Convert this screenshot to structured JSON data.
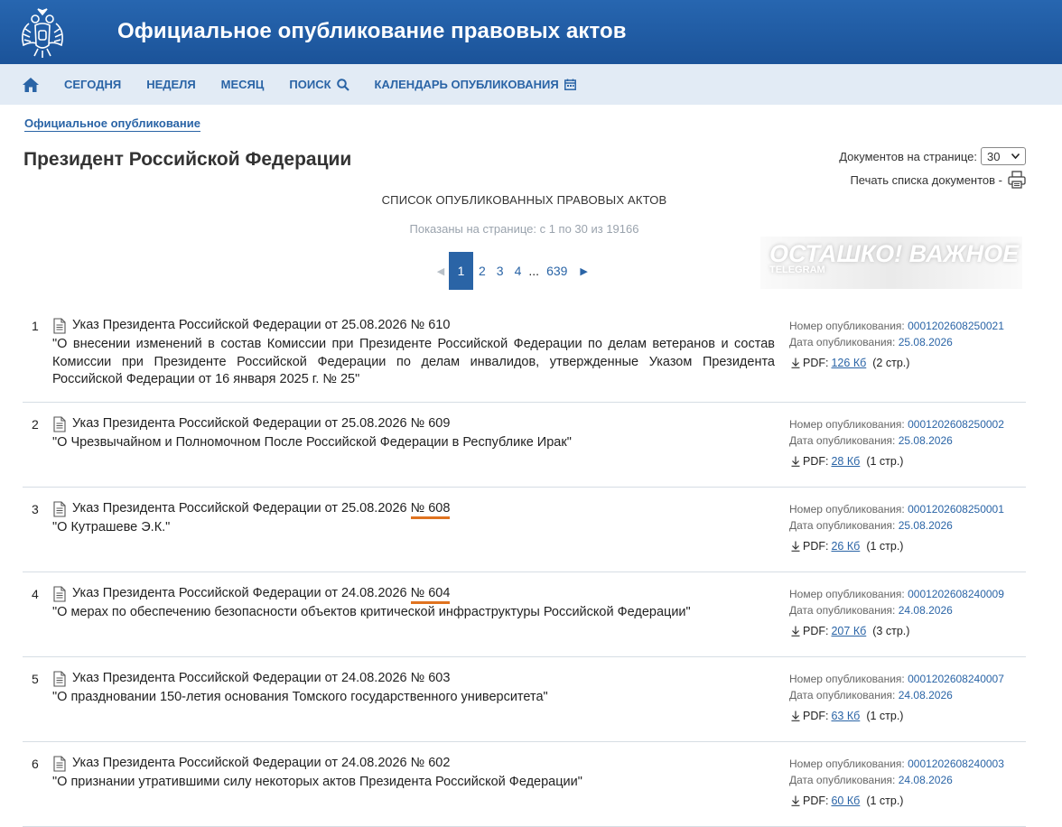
{
  "header": {
    "title": "Официальное опубликование правовых актов"
  },
  "nav": {
    "items": [
      {
        "label": "СЕГОДНЯ"
      },
      {
        "label": "НЕДЕЛЯ"
      },
      {
        "label": "МЕСЯЦ"
      },
      {
        "label": "ПОИСК"
      },
      {
        "label": "КАЛЕНДАРЬ ОПУБЛИКОВАНИЯ"
      }
    ]
  },
  "breadcrumb": "Официальное опубликование",
  "page_title": "Президент Российской Федерации",
  "per_page": {
    "label": "Документов на странице:",
    "value": "30"
  },
  "print_list": "Печать списка документов -",
  "list_heading": "СПИСОК ОПУБЛИКОВАННЫХ ПРАВОВЫХ АКТОВ",
  "shown": "Показаны на странице: с 1 по 30 из 19166",
  "pager": {
    "current": "1",
    "pages": [
      "2",
      "3",
      "4"
    ],
    "dots": "...",
    "last": "639"
  },
  "watermark": {
    "main": "ОСТАШКО! ВАЖНОЕ",
    "sub": "TELEGRAM"
  },
  "labels": {
    "pub_num": "Номер опубликования:",
    "pub_date": "Дата опубликования:",
    "pdf": "PDF:"
  },
  "documents": [
    {
      "n": "1",
      "title": "Указ Президента Российской Федерации от 25.08.2026",
      "num": "№ 610",
      "desc": "\"О внесении изменений в состав Комиссии при Президенте Российской Федерации по делам ветеранов и состав Комиссии при Президенте Российской Федерации по делам инвалидов, утвержденные Указом Президента Российской Федерации от 16 января 2025 г. № 25\"",
      "pub_num": "0001202608250021",
      "pub_date": "25.08.2026",
      "pdf_size": "126 Кб",
      "pages": "(2 стр.)"
    },
    {
      "n": "2",
      "title": "Указ Президента Российской Федерации от 25.08.2026",
      "num": "№ 609",
      "desc": "\"О Чрезвычайном и Полномочном После Российской Федерации в Республике Ирак\"",
      "pub_num": "0001202608250002",
      "pub_date": "25.08.2026",
      "pdf_size": "28 Кб",
      "pages": "(1 стр.)"
    },
    {
      "n": "3",
      "title": "Указ Президента Российской Федерации от 25.08.2026",
      "num": "№ 608",
      "desc": "\"О Кутрашеве Э.К.\"",
      "pub_num": "0001202608250001",
      "pub_date": "25.08.2026",
      "pdf_size": "26 Кб",
      "pages": "(1 стр.)"
    },
    {
      "n": "4",
      "title": "Указ Президента Российской Федерации от 24.08.2026",
      "num": "№ 604",
      "desc": "\"О мерах по обеспечению безопасности объектов критической инфраструктуры Российской Федерации\"",
      "pub_num": "0001202608240009",
      "pub_date": "24.08.2026",
      "pdf_size": "207 Кб",
      "pages": "(3 стр.)"
    },
    {
      "n": "5",
      "title": "Указ Президента Российской Федерации от 24.08.2026",
      "num": "№ 603",
      "desc": "\"О праздновании 150-летия основания Томского государственного университета\"",
      "pub_num": "0001202608240007",
      "pub_date": "24.08.2026",
      "pdf_size": "63 Кб",
      "pages": "(1 стр.)"
    },
    {
      "n": "6",
      "title": "Указ Президента Российской Федерации от 24.08.2026",
      "num": "№ 602",
      "desc": "\"О признании утратившими силу некоторых актов Президента Российской Федерации\"",
      "pub_num": "0001202608240003",
      "pub_date": "24.08.2026",
      "pdf_size": "60 Кб",
      "pages": "(1 стр.)"
    }
  ]
}
